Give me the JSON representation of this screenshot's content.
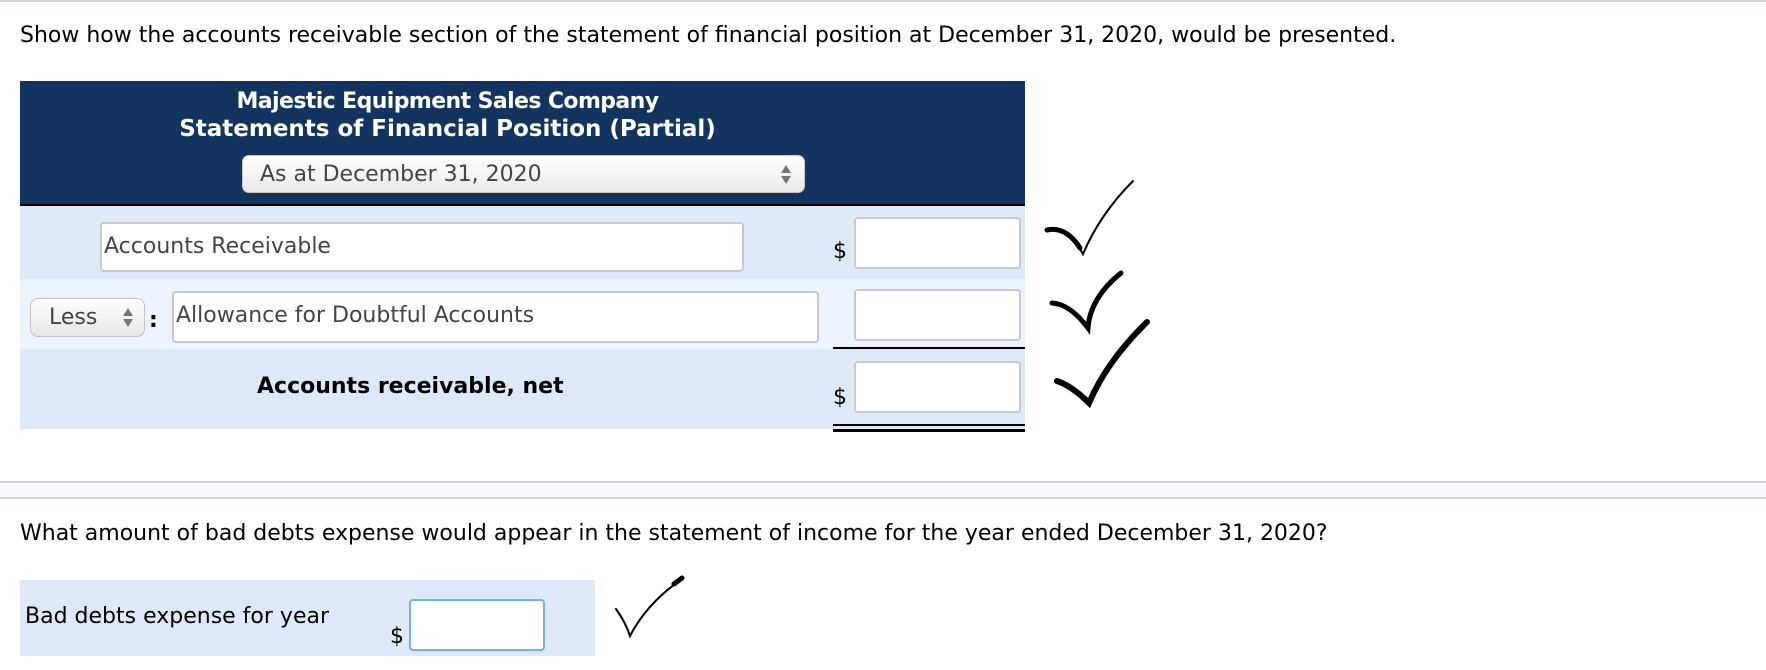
{
  "question1": "Show how the accounts receivable section of the statement of financial position at December 31, 2020, would be presented.",
  "statement": {
    "company": "Majestic Equipment Sales Company",
    "title": "Statements of Financial Position (Partial)",
    "date_select": {
      "selected": "As at December 31, 2020"
    },
    "rows": [
      {
        "account": "Accounts Receivable",
        "currency": "$",
        "amount": ""
      },
      {
        "modifier": "Less",
        "separator": ":",
        "account": "Allowance for Doubtful Accounts",
        "amount": ""
      },
      {
        "label": "Accounts receivable, net",
        "currency": "$",
        "amount": ""
      }
    ]
  },
  "question2": "What amount of bad debts expense would appear in the statement of income for the year ended December 31, 2020?",
  "bad_debts": {
    "label": "Bad debts expense for year",
    "currency": "$",
    "amount": ""
  },
  "marks": [
    "check-mark",
    "check-mark",
    "check-mark",
    "check-mark"
  ],
  "colors": {
    "header_bg": "#12345f",
    "row_bg": "#dfe8f7",
    "row_alt_bg": "#ecf3fd",
    "focus_border": "#7aaede"
  }
}
